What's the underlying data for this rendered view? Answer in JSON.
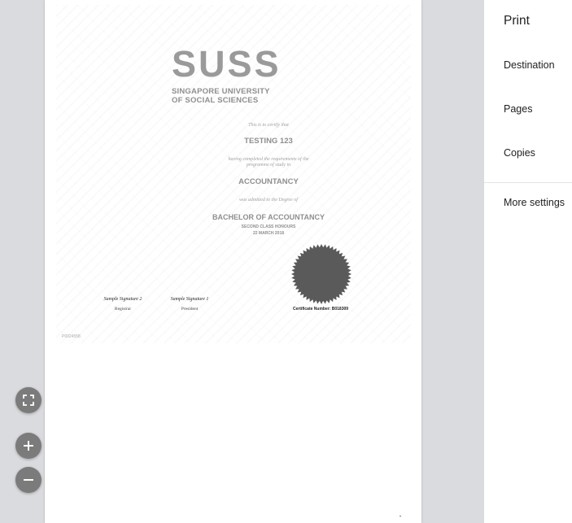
{
  "certificate": {
    "logo_text": "SUSS",
    "university_line1": "SINGAPORE UNIVERSITY",
    "university_line2": "OF SOCIAL SCIENCES",
    "certify_text": "This is to certify that",
    "name": "TESTING 123",
    "completed_line1": "having completed the requirements of the",
    "completed_line2": "programme of study in",
    "programme": "ACCOUNTANCY",
    "admitted_text": "was admitted to the Degree of",
    "degree": "BACHELOR OF ACCOUNTANCY",
    "honours": "SECOND CLASS HONOURS",
    "date": "22 MARCH 2018",
    "signature_registrar": "Sample Signature 2",
    "role_registrar": "Registrar",
    "signature_president": "Sample Signature 1",
    "role_president": "President",
    "certificate_number_label": "Certificate Number:",
    "certificate_number": "B018309",
    "reference": "P0024558",
    "seal_color": "#5a5a5a"
  },
  "zoom_controls": {
    "fit_icon": "fit-to-page-icon",
    "zoom_in_icon": "plus-icon",
    "zoom_out_icon": "minus-icon"
  },
  "print_panel": {
    "title": "Print",
    "destination_label": "Destination",
    "pages_label": "Pages",
    "copies_label": "Copies",
    "more_settings_label": "More settings"
  }
}
